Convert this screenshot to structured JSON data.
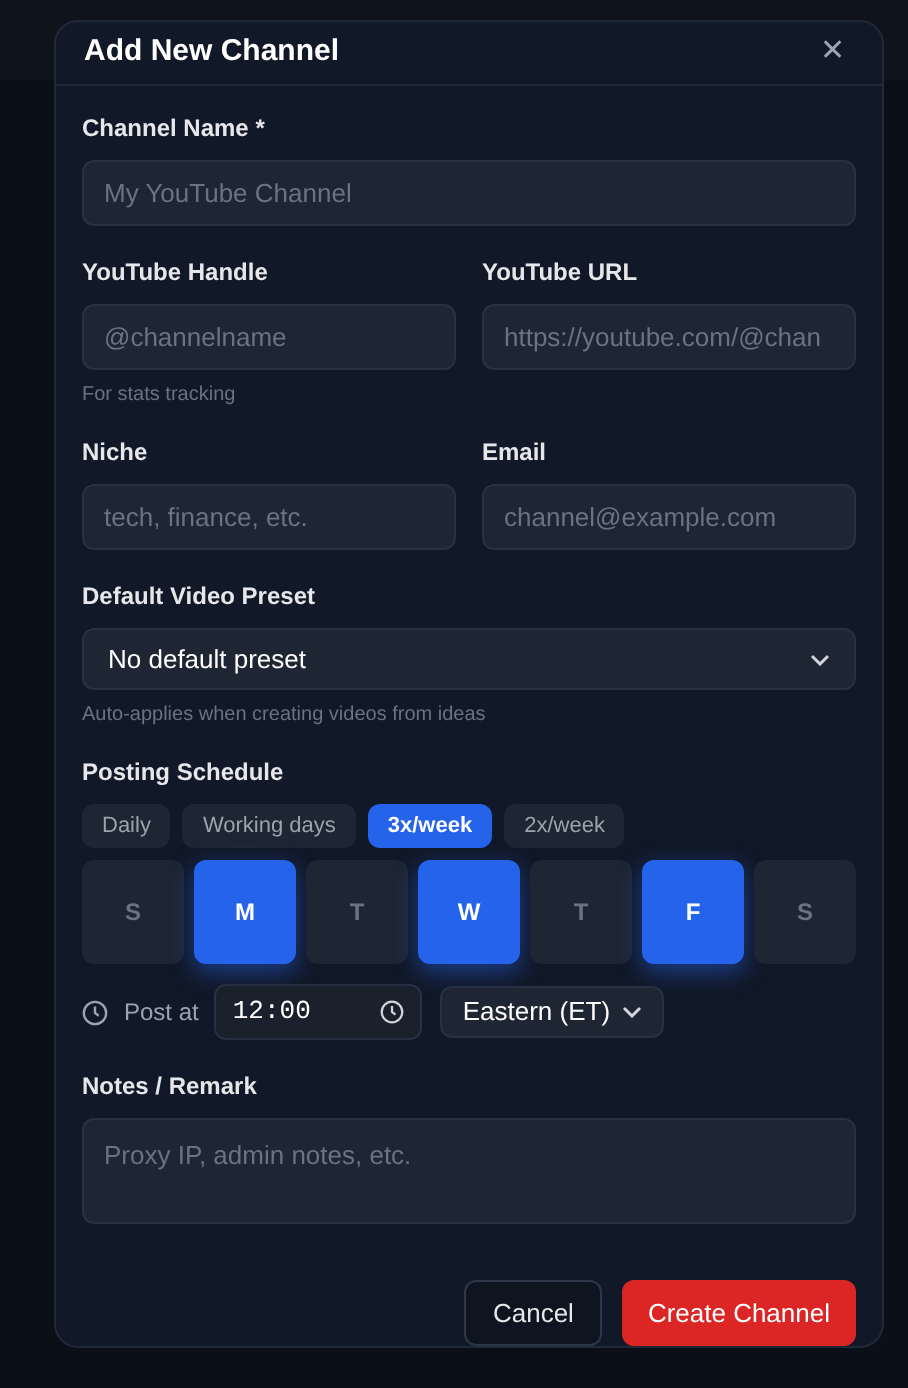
{
  "dialog": {
    "title": "Add New Channel",
    "close": "✕"
  },
  "fields": {
    "channel_name": {
      "label": "Channel Name *",
      "placeholder": "My YouTube Channel"
    },
    "handle": {
      "label": "YouTube Handle",
      "placeholder": "@channelname",
      "hint": "For stats tracking"
    },
    "url": {
      "label": "YouTube URL",
      "placeholder": "https://youtube.com/@chan"
    },
    "niche": {
      "label": "Niche",
      "placeholder": "tech, finance, etc."
    },
    "email": {
      "label": "Email",
      "placeholder": "channel@example.com"
    },
    "preset": {
      "label": "Default Video Preset",
      "value": "No default preset",
      "hint": "Auto-applies when creating videos from ideas"
    }
  },
  "schedule": {
    "label": "Posting Schedule",
    "presets": [
      {
        "label": "Daily",
        "selected": false
      },
      {
        "label": "Working days",
        "selected": false
      },
      {
        "label": "3x/week",
        "selected": true
      },
      {
        "label": "2x/week",
        "selected": false
      }
    ],
    "days": [
      {
        "label": "S",
        "selected": false
      },
      {
        "label": "M",
        "selected": true
      },
      {
        "label": "T",
        "selected": false
      },
      {
        "label": "W",
        "selected": true
      },
      {
        "label": "T",
        "selected": false
      },
      {
        "label": "F",
        "selected": true
      },
      {
        "label": "S",
        "selected": false
      }
    ],
    "post_at_label": "Post at",
    "time": "12:00",
    "timezone": "Eastern (ET)"
  },
  "notes": {
    "label": "Notes / Remark",
    "placeholder": "Proxy IP, admin notes, etc."
  },
  "buttons": [
    {
      "label": "Cancel",
      "kind": "secondary"
    },
    {
      "label": "Create Channel",
      "kind": "primary"
    }
  ]
}
